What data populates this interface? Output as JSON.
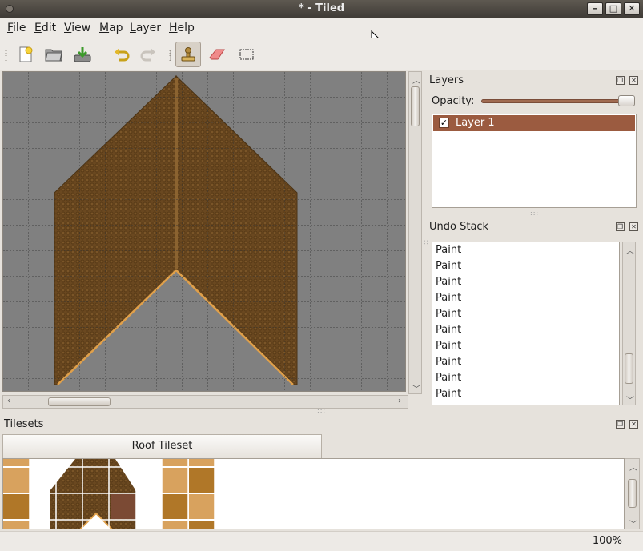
{
  "window": {
    "title": "* - Tiled"
  },
  "window_buttons": {
    "minimize": "–",
    "maximize": "□",
    "close": "✕"
  },
  "menu": {
    "file": {
      "key": "F",
      "rest": "ile"
    },
    "edit": {
      "key": "E",
      "rest": "dit"
    },
    "view": {
      "key": "V",
      "rest": "iew"
    },
    "map": {
      "key": "M",
      "rest": "ap"
    },
    "layer": {
      "key": "L",
      "rest": "ayer"
    },
    "help": {
      "key": "H",
      "rest": "elp"
    }
  },
  "toolbar": {
    "icons": [
      "new-map-icon",
      "open-folder-icon",
      "save-icon",
      "undo-icon",
      "redo-icon",
      "stamp-brush-icon",
      "eraser-icon",
      "rectangle-select-icon"
    ],
    "active_tool": "stamp-brush-icon"
  },
  "layers_panel": {
    "title": "Layers",
    "opacity_label": "Opacity:",
    "opacity_value": 1.0,
    "layers": [
      {
        "name": "Layer 1",
        "visible": true,
        "selected": true
      }
    ]
  },
  "undo_panel": {
    "title": "Undo Stack",
    "items": [
      "Paint",
      "Paint",
      "Paint",
      "Paint",
      "Paint",
      "Paint",
      "Paint",
      "Paint",
      "Paint",
      "Paint"
    ]
  },
  "tilesets_panel": {
    "title": "Tilesets",
    "tabs": [
      "Roof Tileset"
    ]
  },
  "status": {
    "zoom": "100%"
  },
  "colors": {
    "accent": "#9b5b40",
    "canvas_bg": "#808080",
    "roof": "#6b4a22",
    "roof_edge": "#e0a04a"
  }
}
